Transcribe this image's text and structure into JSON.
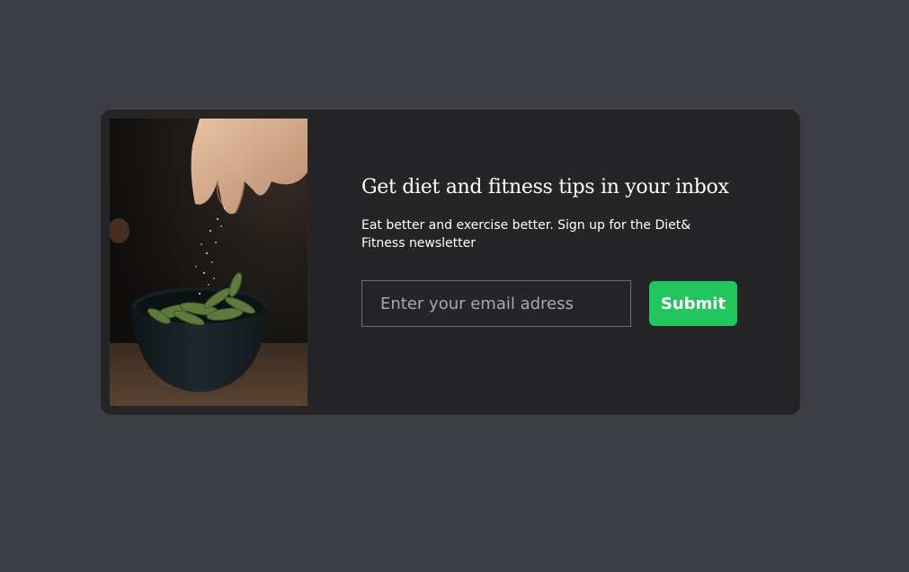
{
  "newsletter": {
    "image_alt": "Hand sprinkling salt over a bowl of edamame",
    "title": "Get diet and fitness tips in your inbox",
    "description": "Eat better and exercise better. Sign up for the Diet& Fitness newsletter",
    "email_placeholder": "Enter your email adress",
    "email_value": "",
    "submit_label": "Submit"
  },
  "colors": {
    "page_background": "#3d3e45",
    "card_background": "#252528",
    "accent": "#22c55e",
    "text": "#ffffff",
    "placeholder": "#a9a9ad"
  }
}
